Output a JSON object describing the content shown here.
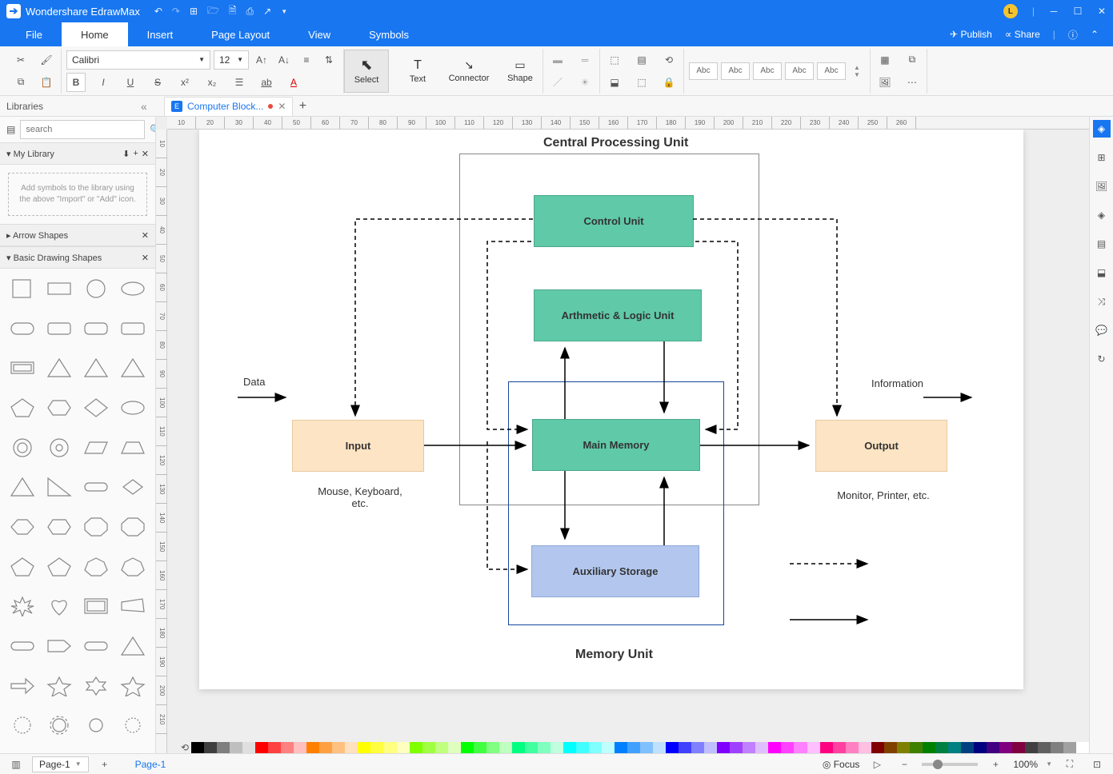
{
  "app": {
    "name": "Wondershare EdrawMax",
    "avatar_letter": "L"
  },
  "menubar": {
    "tabs": [
      "File",
      "Home",
      "Insert",
      "Page Layout",
      "View",
      "Symbols"
    ],
    "active": 1,
    "publish": "Publish",
    "share": "Share"
  },
  "ribbon": {
    "font_name": "Calibri",
    "font_size": "12",
    "tools": {
      "select": "Select",
      "text": "Text",
      "connector": "Connector",
      "shape": "Shape"
    },
    "abc": "Abc"
  },
  "doc_tab": {
    "title": "Computer Block..."
  },
  "sidebar": {
    "title": "Libraries",
    "search_placeholder": "search",
    "my_library": "My Library",
    "empty_text": "Add symbols to the library using the above \"Import\" or \"Add\" icon.",
    "arrow_shapes": "Arrow Shapes",
    "basic_shapes": "Basic Drawing Shapes"
  },
  "diagram": {
    "title_cpu": "Central Processing Unit",
    "control_unit": "Control Unit",
    "alu": "Arthmetic & Logic Unit",
    "main_memory": "Main Memory",
    "aux_storage": "Auxiliary Storage",
    "input": "Input",
    "output": "Output",
    "data": "Data",
    "information": "Information",
    "input_sub": "Mouse, Keyboard, etc.",
    "output_sub": "Monitor, Printer, etc.",
    "memory_unit": "Memory Unit"
  },
  "status": {
    "page_combo": "Page-1",
    "page_tab": "Page-1",
    "focus": "Focus",
    "zoom": "100%"
  },
  "ruler_h": [
    "10",
    "20",
    "30",
    "40",
    "50",
    "60",
    "70",
    "80",
    "90",
    "100",
    "110",
    "120",
    "130",
    "140",
    "150",
    "160",
    "170",
    "180",
    "190",
    "200",
    "210",
    "220",
    "230",
    "240",
    "250",
    "260"
  ],
  "ruler_v": [
    "10",
    "20",
    "30",
    "40",
    "50",
    "60",
    "70",
    "80",
    "90",
    "100",
    "110",
    "120",
    "130",
    "140",
    "150",
    "160",
    "170",
    "180",
    "190",
    "200",
    "210"
  ],
  "colors": [
    "#000",
    "#3f3f3f",
    "#7f7f7f",
    "#bfbfbf",
    "#dfdfdf",
    "#ff0000",
    "#ff4040",
    "#ff8080",
    "#ffbfbf",
    "#ff8000",
    "#ffa040",
    "#ffc080",
    "#ffe0bf",
    "#ffff00",
    "#ffff40",
    "#ffff80",
    "#ffffbf",
    "#80ff00",
    "#a0ff40",
    "#c0ff80",
    "#e0ffbf",
    "#00ff00",
    "#40ff40",
    "#80ff80",
    "#bfffbf",
    "#00ff80",
    "#40ffa0",
    "#80ffc0",
    "#bfffe0",
    "#00ffff",
    "#40ffff",
    "#80ffff",
    "#bfffff",
    "#0080ff",
    "#40a0ff",
    "#80c0ff",
    "#bfe0ff",
    "#0000ff",
    "#4040ff",
    "#8080ff",
    "#bfbfff",
    "#8000ff",
    "#a040ff",
    "#c080ff",
    "#e0bfff",
    "#ff00ff",
    "#ff40ff",
    "#ff80ff",
    "#ffbfff",
    "#ff0080",
    "#ff40a0",
    "#ff80c0",
    "#ffbfe0",
    "#800000",
    "#804000",
    "#808000",
    "#408000",
    "#008000",
    "#008040",
    "#008080",
    "#004080",
    "#000080",
    "#400080",
    "#800080",
    "#800040",
    "#404040",
    "#606060",
    "#808080",
    "#a0a0a0",
    "#fff"
  ]
}
